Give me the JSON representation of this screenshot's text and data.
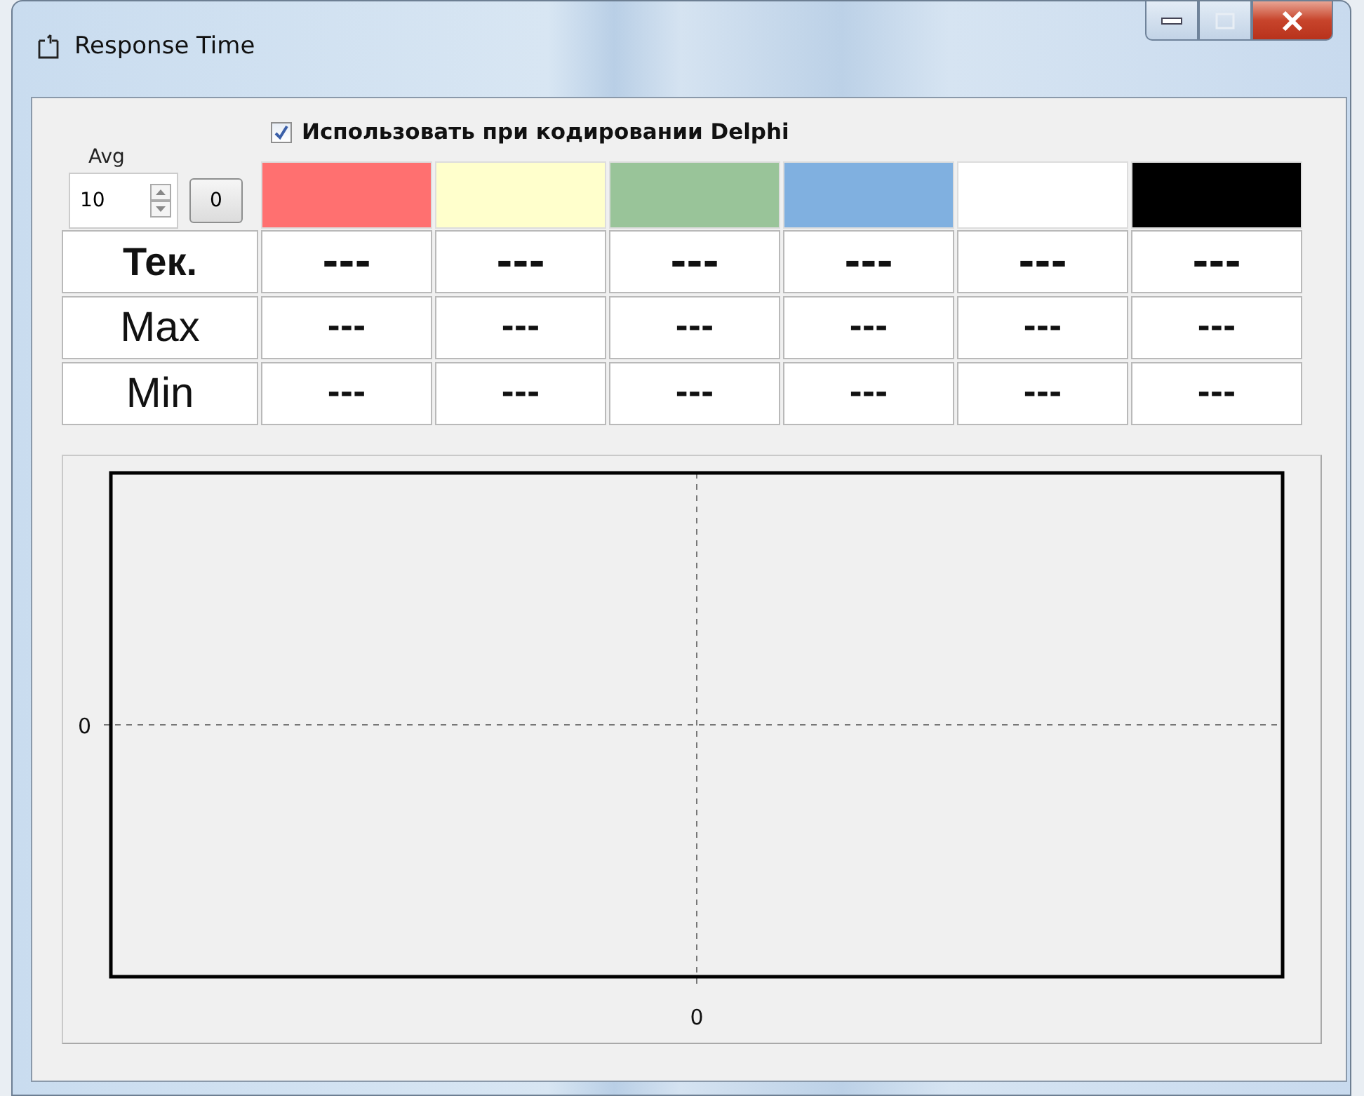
{
  "window": {
    "title": "Response Time"
  },
  "use_in_coding": {
    "label": "Использовать при кодировании Delphi",
    "checked": true
  },
  "avg": {
    "label": "Avg",
    "value": "10",
    "reset_button": "0"
  },
  "swatches": [
    {
      "color": "#ff7070"
    },
    {
      "color": "#ffffcc"
    },
    {
      "color": "#99c499"
    },
    {
      "color": "#80b0e0"
    },
    {
      "color": "#ffffff"
    },
    {
      "color": "#000000"
    }
  ],
  "rows": [
    {
      "kind": "current",
      "label": "Тек.",
      "cells": [
        "---",
        "---",
        "---",
        "---",
        "---",
        "---"
      ]
    },
    {
      "kind": "plain",
      "label": "Max",
      "cells": [
        "---",
        "---",
        "---",
        "---",
        "---",
        "---"
      ]
    },
    {
      "kind": "plain",
      "label": "Min",
      "cells": [
        "---",
        "---",
        "---",
        "---",
        "---",
        "---"
      ]
    }
  ],
  "chart": {
    "y_axis_label": "0",
    "x_axis_label": "0"
  }
}
